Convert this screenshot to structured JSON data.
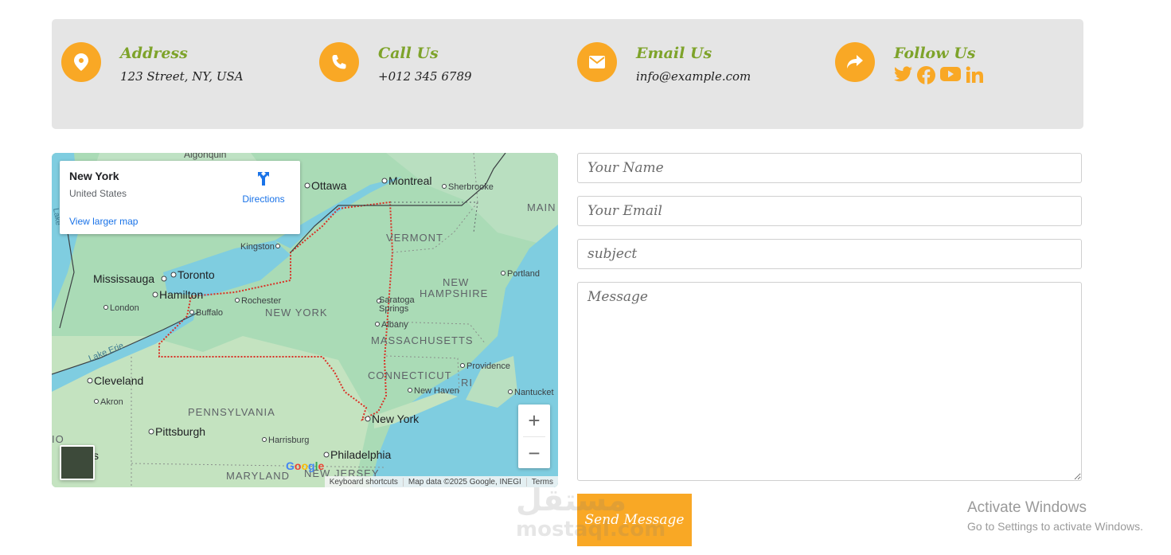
{
  "info": [
    {
      "title": "Address",
      "value": "123 Street, NY, USA",
      "icon": "map-pin-icon"
    },
    {
      "title": "Call Us",
      "value": "+012 345 6789",
      "icon": "phone-icon"
    },
    {
      "title": "Email Us",
      "value": "info@example.com",
      "icon": "envelope-icon"
    },
    {
      "title": "Follow Us",
      "icon": "share-icon",
      "social": [
        "twitter-icon",
        "facebook-icon",
        "youtube-icon",
        "linkedin-icon"
      ]
    }
  ],
  "colors": {
    "accent": "#f9a825",
    "title_green": "#7ea32a",
    "info_bg": "#e5e5e5",
    "link_blue": "#1a73e8"
  },
  "map": {
    "place_name": "New York",
    "place_country": "United States",
    "directions_label": "Directions",
    "larger_map_label": "View larger map",
    "zoom_in": "+",
    "zoom_out": "−",
    "google_logo": "Google",
    "attribution": [
      "Keyboard shortcuts",
      "Map data ©2025 Google, INEGI",
      "Terms"
    ],
    "labels": {
      "algonquin": "Algonquin",
      "ottawa": "Ottawa",
      "montreal": "Montreal",
      "sherbrooke": "Sherbrooke",
      "maine": "MAIN",
      "kingston": "Kingston",
      "vermont": "VERMONT",
      "mississauga": "Mississauga",
      "toronto": "Toronto",
      "portland": "Portland",
      "new_hampshire_1": "NEW",
      "new_hampshire_2": "HAMPSHIRE",
      "hamilton": "Hamilton",
      "rochester": "Rochester",
      "london": "London",
      "buffalo": "Buffalo",
      "new_york_state": "NEW YORK",
      "saratoga_1": "Saratoga",
      "saratoga_2": "Springs",
      "albany": "Albany",
      "lake_erie": "Lake Erie",
      "massachusetts": "MASSACHUSETTS",
      "providence": "Providence",
      "connecticut": "CONNECTICUT",
      "ri": "RI",
      "cleveland": "Cleveland",
      "new_haven": "New Haven",
      "nantucket": "Nantucket",
      "akron": "Akron",
      "pennsylvania": "PENNSYLVANIA",
      "new_york_city": "New York",
      "ohio": "IO",
      "pittsburgh": "Pittsburgh",
      "harrisburg": "Harrisburg",
      "columbus": "s",
      "philadelphia": "Philadelphia",
      "maryland": "MARYLAND",
      "new_jersey": "NEW JERSEY",
      "lake_label": "Lake"
    }
  },
  "form": {
    "name_placeholder": "Your Name",
    "email_placeholder": "Your Email",
    "subject_placeholder": "subject",
    "message_placeholder": "Message",
    "submit_label": "Send Message"
  },
  "watermark": {
    "line1": "مستقل",
    "line2": "mostaql.com"
  },
  "system_notice": {
    "title": "Activate Windows",
    "subtitle": "Go to Settings to activate Windows."
  }
}
